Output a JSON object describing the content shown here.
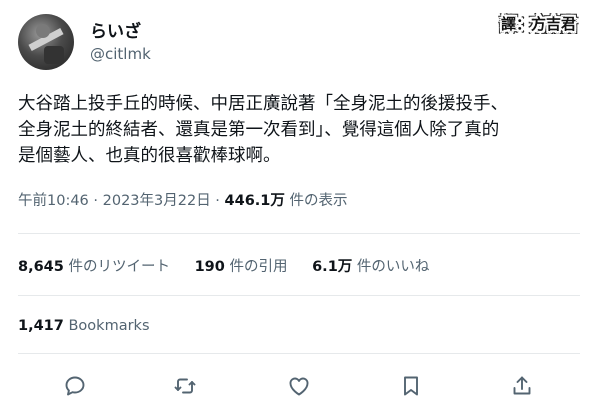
{
  "author": {
    "name": "らいざ",
    "handle": "@citlmk"
  },
  "credit": "譯：方吉君",
  "tweet": {
    "lines": [
      "大谷踏上投手丘的時候、中居正廣說著「全身泥土的後援投手、",
      "全身泥土的終結者、還真是第一次看到」、覺得這個人除了真的",
      "是個藝人、也真的很喜歡棒球啊。"
    ]
  },
  "meta": {
    "timestamp": "午前10:46 · 2023年3月22日 · ",
    "views_count": "446.1万",
    "views_label": " 件の表示"
  },
  "stats": {
    "retweets_count": "8,645",
    "retweets_label": " 件のリツイート",
    "quotes_count": "190",
    "quotes_label": " 件の引用",
    "likes_count": "6.1万",
    "likes_label": " 件のいいね"
  },
  "bookmarks": {
    "count": "1,417",
    "label": " Bookmarks"
  },
  "actions": [
    "reply-icon",
    "retweet-icon",
    "like-icon",
    "bookmark-icon",
    "share-icon"
  ],
  "colors": {
    "text": "#0f1419",
    "secondary": "#536471",
    "divider": "#e6e9eb"
  }
}
